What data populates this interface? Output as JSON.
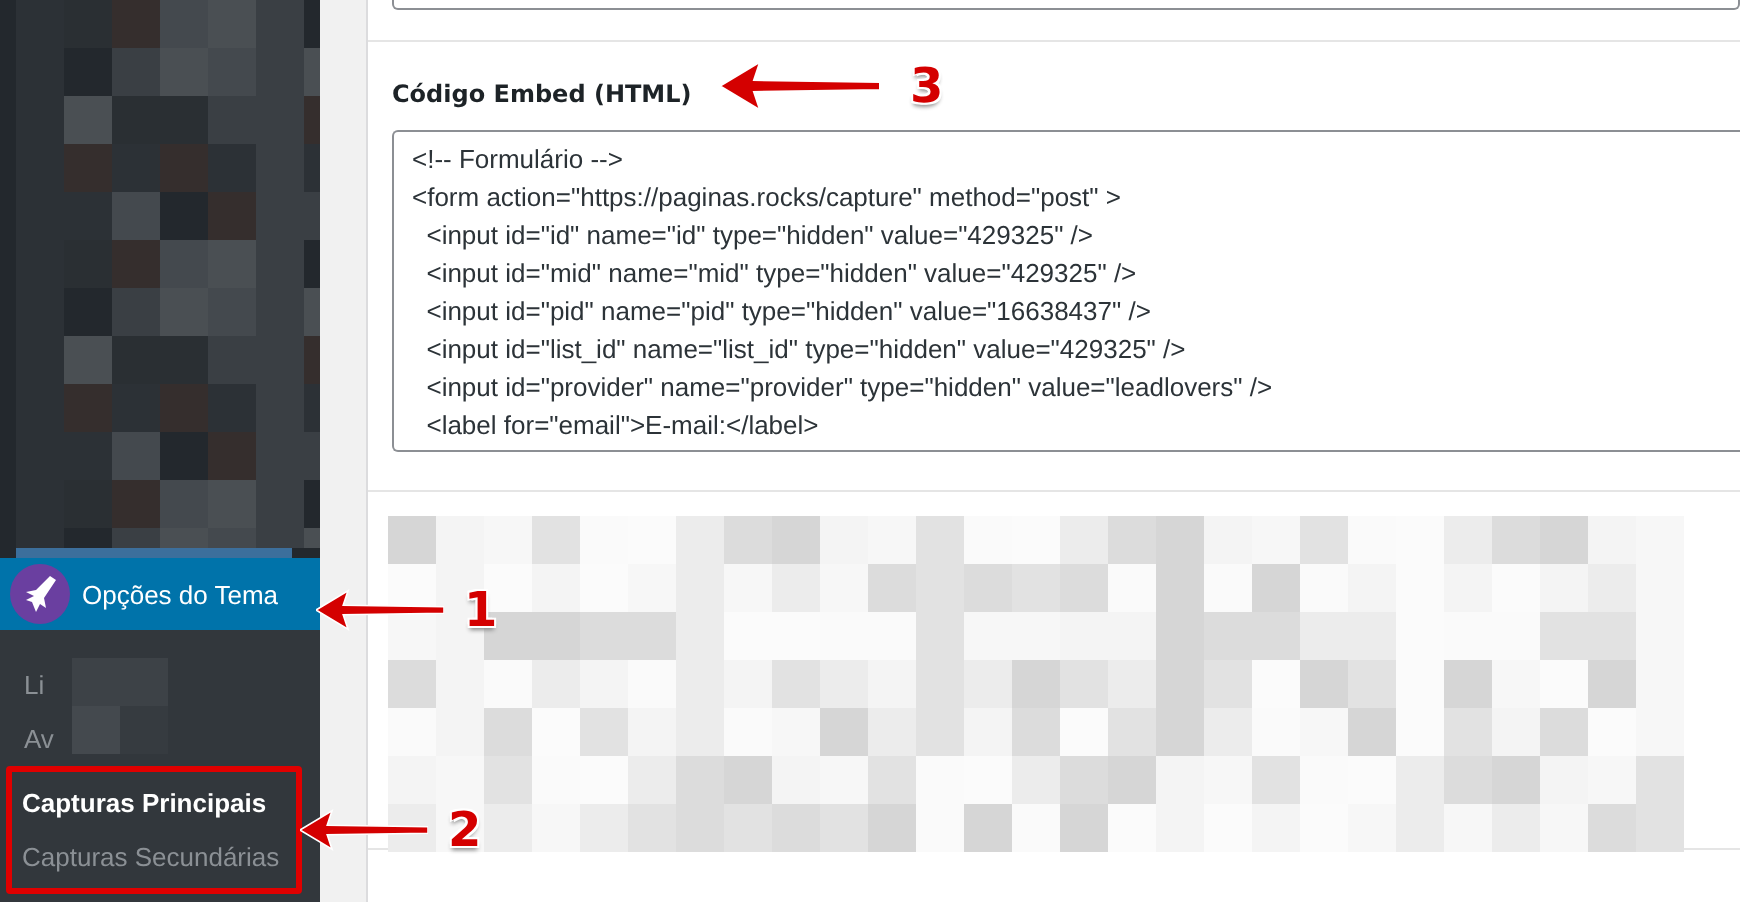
{
  "sidebar": {
    "menu_items": [
      {
        "label": "Opções do Tema",
        "selected": true
      }
    ],
    "submenu": [
      {
        "label": "Li",
        "selected": false
      },
      {
        "label": "Av",
        "selected": false
      },
      {
        "label": "Capturas Principais",
        "selected": true
      },
      {
        "label": "Capturas Secundárias",
        "selected": false
      }
    ]
  },
  "embed": {
    "label": "Código Embed (HTML)",
    "code_lines": [
      "<!-- Formulário -->",
      "<form action=\"https://paginas.rocks/capture\" method=\"post\" >",
      "  <input id=\"id\" name=\"id\" type=\"hidden\" value=\"429325\" />",
      "  <input id=\"mid\" name=\"mid\" type=\"hidden\" value=\"429325\" />",
      "  <input id=\"pid\" name=\"pid\" type=\"hidden\" value=\"16638437\" />",
      "  <input id=\"list_id\" name=\"list_id\" type=\"hidden\" value=\"429325\" />",
      "  <input id=\"provider\" name=\"provider\" type=\"hidden\" value=\"leadlovers\" />",
      "  <label for=\"email\">E-mail:</label>"
    ]
  },
  "annotations": [
    {
      "number": "1"
    },
    {
      "number": "2"
    },
    {
      "number": "3"
    }
  ]
}
